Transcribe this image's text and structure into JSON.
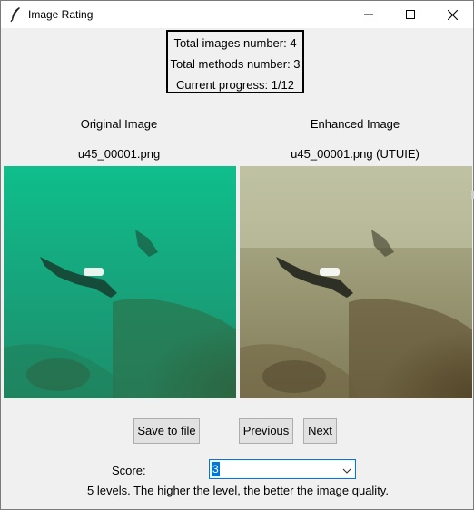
{
  "window": {
    "title": "Image Rating",
    "icons": {
      "app": "feather-icon",
      "minimize": "minimize-icon",
      "maximize": "maximize-icon",
      "close": "close-icon"
    }
  },
  "progress": {
    "total_images": "Total images number: 4",
    "total_methods": "Total methods number: 3",
    "current_progress": "Current progress: 1/12"
  },
  "original": {
    "heading": "Original Image",
    "filename": "u45_00001.png"
  },
  "enhanced": {
    "heading": "Enhanced Image",
    "filename": "u45_00001.png (UTUIE)"
  },
  "buttons": {
    "save": "Save to file",
    "previous": "Previous",
    "next": "Next"
  },
  "score": {
    "label": "Score:",
    "value": "3",
    "hint": "5 levels. The higher the level, the better the image quality."
  },
  "colors": {
    "original_water": "#17b487",
    "enhanced_water": "#8f9170",
    "focus_accent": "#0078d7"
  }
}
